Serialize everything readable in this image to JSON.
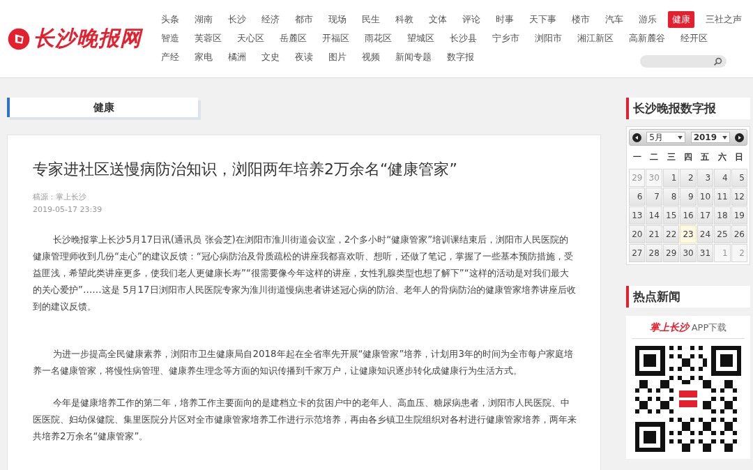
{
  "site": {
    "logo_text": "长沙晚报网"
  },
  "nav_rows": [
    [
      {
        "label": "头条",
        "selected": false
      },
      {
        "label": "湖南",
        "selected": false
      },
      {
        "label": "长沙",
        "selected": false
      },
      {
        "label": "经济",
        "selected": false
      },
      {
        "label": "都市",
        "selected": false
      },
      {
        "label": "现场",
        "selected": false
      },
      {
        "label": "民生",
        "selected": false
      },
      {
        "label": "科教",
        "selected": false
      },
      {
        "label": "文体",
        "selected": false
      },
      {
        "label": "评论",
        "selected": false
      },
      {
        "label": "时事",
        "selected": false
      },
      {
        "label": "天下事",
        "selected": false
      },
      {
        "label": "楼市",
        "selected": false
      },
      {
        "label": "汽车",
        "selected": false
      },
      {
        "label": "游乐",
        "selected": false
      },
      {
        "label": "健康",
        "selected": true
      },
      {
        "label": "三社之声",
        "selected": false
      }
    ],
    [
      {
        "label": "智造",
        "selected": false
      },
      {
        "label": "芙蓉区",
        "selected": false
      },
      {
        "label": "天心区",
        "selected": false
      },
      {
        "label": "岳麓区",
        "selected": false
      },
      {
        "label": "开福区",
        "selected": false
      },
      {
        "label": "雨花区",
        "selected": false
      },
      {
        "label": "望城区",
        "selected": false
      },
      {
        "label": "长沙县",
        "selected": false
      },
      {
        "label": "宁乡市",
        "selected": false
      },
      {
        "label": "浏阳市",
        "selected": false
      },
      {
        "label": "湘江新区",
        "selected": false
      },
      {
        "label": "高新麓谷",
        "selected": false
      },
      {
        "label": "经开区",
        "selected": false
      }
    ],
    [
      {
        "label": "产经",
        "selected": false
      },
      {
        "label": "家电",
        "selected": false
      },
      {
        "label": "橘洲",
        "selected": false
      },
      {
        "label": "文史",
        "selected": false
      },
      {
        "label": "夜读",
        "selected": false
      },
      {
        "label": "图片",
        "selected": false
      },
      {
        "label": "视频",
        "selected": false
      },
      {
        "label": "新闻专题",
        "selected": false
      },
      {
        "label": "数字报",
        "selected": false
      }
    ]
  ],
  "section_tab": "健康",
  "article": {
    "title": "专家进社区送慢病防治知识，浏阳两年培养2万余名“健康管家”",
    "source": "稿源：掌上长沙",
    "date": "2019-05-17 23:39",
    "paragraphs": [
      "长沙晚报掌上长沙5月17日讯(通讯员 张会芝)在浏阳市淮川街道会议室，2个多小时“健康管家”培训课结束后，浏阳市人民医院的健康管理师收到几份“走心”的建议反馈：“冠心病防治及骨质疏松的讲座我都喜欢听、想听，还做了笔记，掌握了一些基本预防措施，受益匪浅，希望此类讲座更多，使我们老人更健康长寿”“很需要像今年这样的讲座，女性乳腺类型也想了解下”“这样的活动是对我们最大的关心爱护”……这是 5月17日浏阳市人民医院专家为淮川街道慢病患者讲述冠心病的防治、老年人的骨病防治的健康管家培养讲座后收到的建议反馈。",
      "为进一步提高全民健康素养，浏阳市卫生健康局自2018年起在全省率先开展“健康管家”培养，计划用3年的时间为全市每户家庭培养一名健康管家，将慢性病管理、健康养生理念等方面的知识传播到千家万户，让健康知识逐步转化成健康行为生活方式。",
      "今年是健康培养工作的第二年，培养工作主要面向的是建档立卡的贫困户中的老年人、高血压、糖尿病患者，浏阳市人民医院、中医医院、妇幼保健院、集里医院分片区对全市健康管家培养工作进行示范培养，再由各乡镇卫生院组织对各村进行健康管家培养，两年来共培养2万余名“健康管家”。"
    ]
  },
  "sidebar": {
    "epaper_title": "长沙晚报数字报",
    "calendar": {
      "month": "5月",
      "year": "2019",
      "weekdays": [
        "一",
        "二",
        "三",
        "四",
        "五",
        "六",
        "日"
      ],
      "weeks": [
        [
          {
            "label": "29",
            "kind": "other",
            "selected": false
          },
          {
            "label": "30",
            "kind": "other",
            "selected": false
          },
          {
            "label": "1",
            "kind": "day",
            "selected": false
          },
          {
            "label": "2",
            "kind": "day",
            "selected": false
          },
          {
            "label": "3",
            "kind": "day",
            "selected": false
          },
          {
            "label": "4",
            "kind": "day",
            "selected": false
          },
          {
            "label": "5",
            "kind": "day",
            "selected": false
          }
        ],
        [
          {
            "label": "6",
            "kind": "day",
            "selected": false
          },
          {
            "label": "7",
            "kind": "day",
            "selected": false
          },
          {
            "label": "8",
            "kind": "day",
            "selected": false
          },
          {
            "label": "9",
            "kind": "day",
            "selected": false
          },
          {
            "label": "10",
            "kind": "day",
            "selected": false
          },
          {
            "label": "11",
            "kind": "day",
            "selected": false
          },
          {
            "label": "12",
            "kind": "day",
            "selected": false
          }
        ],
        [
          {
            "label": "13",
            "kind": "day",
            "selected": false
          },
          {
            "label": "14",
            "kind": "day",
            "selected": false
          },
          {
            "label": "15",
            "kind": "day",
            "selected": false
          },
          {
            "label": "16",
            "kind": "day",
            "selected": false
          },
          {
            "label": "17",
            "kind": "day",
            "selected": false
          },
          {
            "label": "18",
            "kind": "day",
            "selected": false
          },
          {
            "label": "19",
            "kind": "day",
            "selected": false
          }
        ],
        [
          {
            "label": "20",
            "kind": "day",
            "selected": false
          },
          {
            "label": "21",
            "kind": "day",
            "selected": false
          },
          {
            "label": "22",
            "kind": "day",
            "selected": false
          },
          {
            "label": "23",
            "kind": "day",
            "selected": true
          },
          {
            "label": "24",
            "kind": "day",
            "selected": false
          },
          {
            "label": "25",
            "kind": "day",
            "selected": false
          },
          {
            "label": "26",
            "kind": "day",
            "selected": false
          }
        ],
        [
          {
            "label": "27",
            "kind": "day",
            "selected": false
          },
          {
            "label": "28",
            "kind": "day",
            "selected": false
          },
          {
            "label": "29",
            "kind": "day",
            "selected": false
          },
          {
            "label": "30",
            "kind": "day",
            "selected": false
          },
          {
            "label": "31",
            "kind": "day",
            "selected": false
          },
          {
            "label": "1",
            "kind": "other",
            "selected": false
          },
          {
            "label": "2",
            "kind": "other",
            "selected": false
          }
        ]
      ]
    },
    "hot_title": "热点新闻",
    "app_brand": "掌上长沙",
    "app_download": "APP下载"
  }
}
